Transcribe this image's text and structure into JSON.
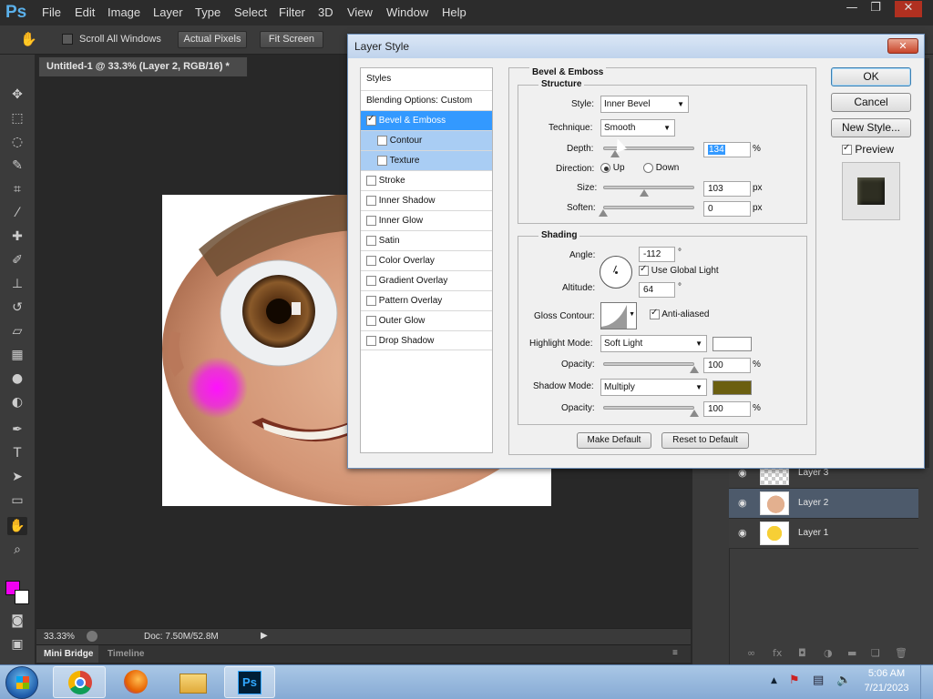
{
  "app": {
    "logo": "Ps"
  },
  "menu": [
    "File",
    "Edit",
    "Image",
    "Layer",
    "Type",
    "Select",
    "Filter",
    "3D",
    "View",
    "Window",
    "Help"
  ],
  "window_controls": {
    "minimize": "—",
    "restore": "❐",
    "close": "✕"
  },
  "options_bar": {
    "scroll_all_windows": "Scroll All Windows",
    "actual_pixels": "Actual Pixels",
    "fit_screen": "Fit Screen"
  },
  "document": {
    "tab_title": "Untitled-1 @ 33.3% (Layer 2, RGB/16) *",
    "zoom": "33.33%",
    "doc_size": "Doc: 7.50M/52.8M"
  },
  "bottom_tabs": {
    "mini_bridge": "Mini Bridge",
    "timeline": "Timeline"
  },
  "layers": [
    {
      "name": "Layer 3"
    },
    {
      "name": "Layer 2"
    },
    {
      "name": "Layer 1"
    }
  ],
  "colors": {
    "foreground": "#f000f0",
    "background": "#ffffff",
    "highlight": "#ffffff",
    "shadow": "#6b5f10"
  },
  "dialog": {
    "title": "Layer Style",
    "styles_header": "Styles",
    "blending_options": "Blending Options: Custom",
    "styles": [
      {
        "label": "Bevel & Emboss",
        "checked": true
      },
      {
        "label": "Contour",
        "checked": false
      },
      {
        "label": "Texture",
        "checked": false
      },
      {
        "label": "Stroke",
        "checked": false
      },
      {
        "label": "Inner Shadow",
        "checked": false
      },
      {
        "label": "Inner Glow",
        "checked": false
      },
      {
        "label": "Satin",
        "checked": false
      },
      {
        "label": "Color Overlay",
        "checked": false
      },
      {
        "label": "Gradient Overlay",
        "checked": false
      },
      {
        "label": "Pattern Overlay",
        "checked": false
      },
      {
        "label": "Outer Glow",
        "checked": false
      },
      {
        "label": "Drop Shadow",
        "checked": false
      }
    ],
    "section_title": "Bevel & Emboss",
    "structure": {
      "title": "Structure",
      "style_label": "Style:",
      "style_value": "Inner Bevel",
      "technique_label": "Technique:",
      "technique_value": "Smooth",
      "depth_label": "Depth:",
      "depth_value": "134",
      "depth_unit": "%",
      "direction_label": "Direction:",
      "up": "Up",
      "down": "Down",
      "size_label": "Size:",
      "size_value": "103",
      "size_unit": "px",
      "soften_label": "Soften:",
      "soften_value": "0",
      "soften_unit": "px"
    },
    "shading": {
      "title": "Shading",
      "angle_label": "Angle:",
      "angle_value": "-112",
      "angle_unit": "°",
      "use_global_light": "Use Global Light",
      "altitude_label": "Altitude:",
      "altitude_value": "64",
      "altitude_unit": "°",
      "gloss_contour_label": "Gloss Contour:",
      "anti_aliased": "Anti-aliased",
      "highlight_mode_label": "Highlight Mode:",
      "highlight_mode_value": "Soft Light",
      "opacity_label": "Opacity:",
      "highlight_opacity": "100",
      "opacity_unit": "%",
      "shadow_mode_label": "Shadow Mode:",
      "shadow_mode_value": "Multiply",
      "shadow_opacity": "100"
    },
    "make_default": "Make Default",
    "reset_default": "Reset to Default",
    "ok": "OK",
    "cancel": "Cancel",
    "new_style": "New Style...",
    "preview": "Preview",
    "slider_levels": {
      "depth": 0.13,
      "size": 0.45,
      "soften": 0.0,
      "highlight_opacity": 1.0,
      "shadow_opacity": 1.0
    }
  },
  "taskbar": {
    "time": "5:06 AM",
    "date": "7/21/2023",
    "ps_label": "Ps"
  }
}
